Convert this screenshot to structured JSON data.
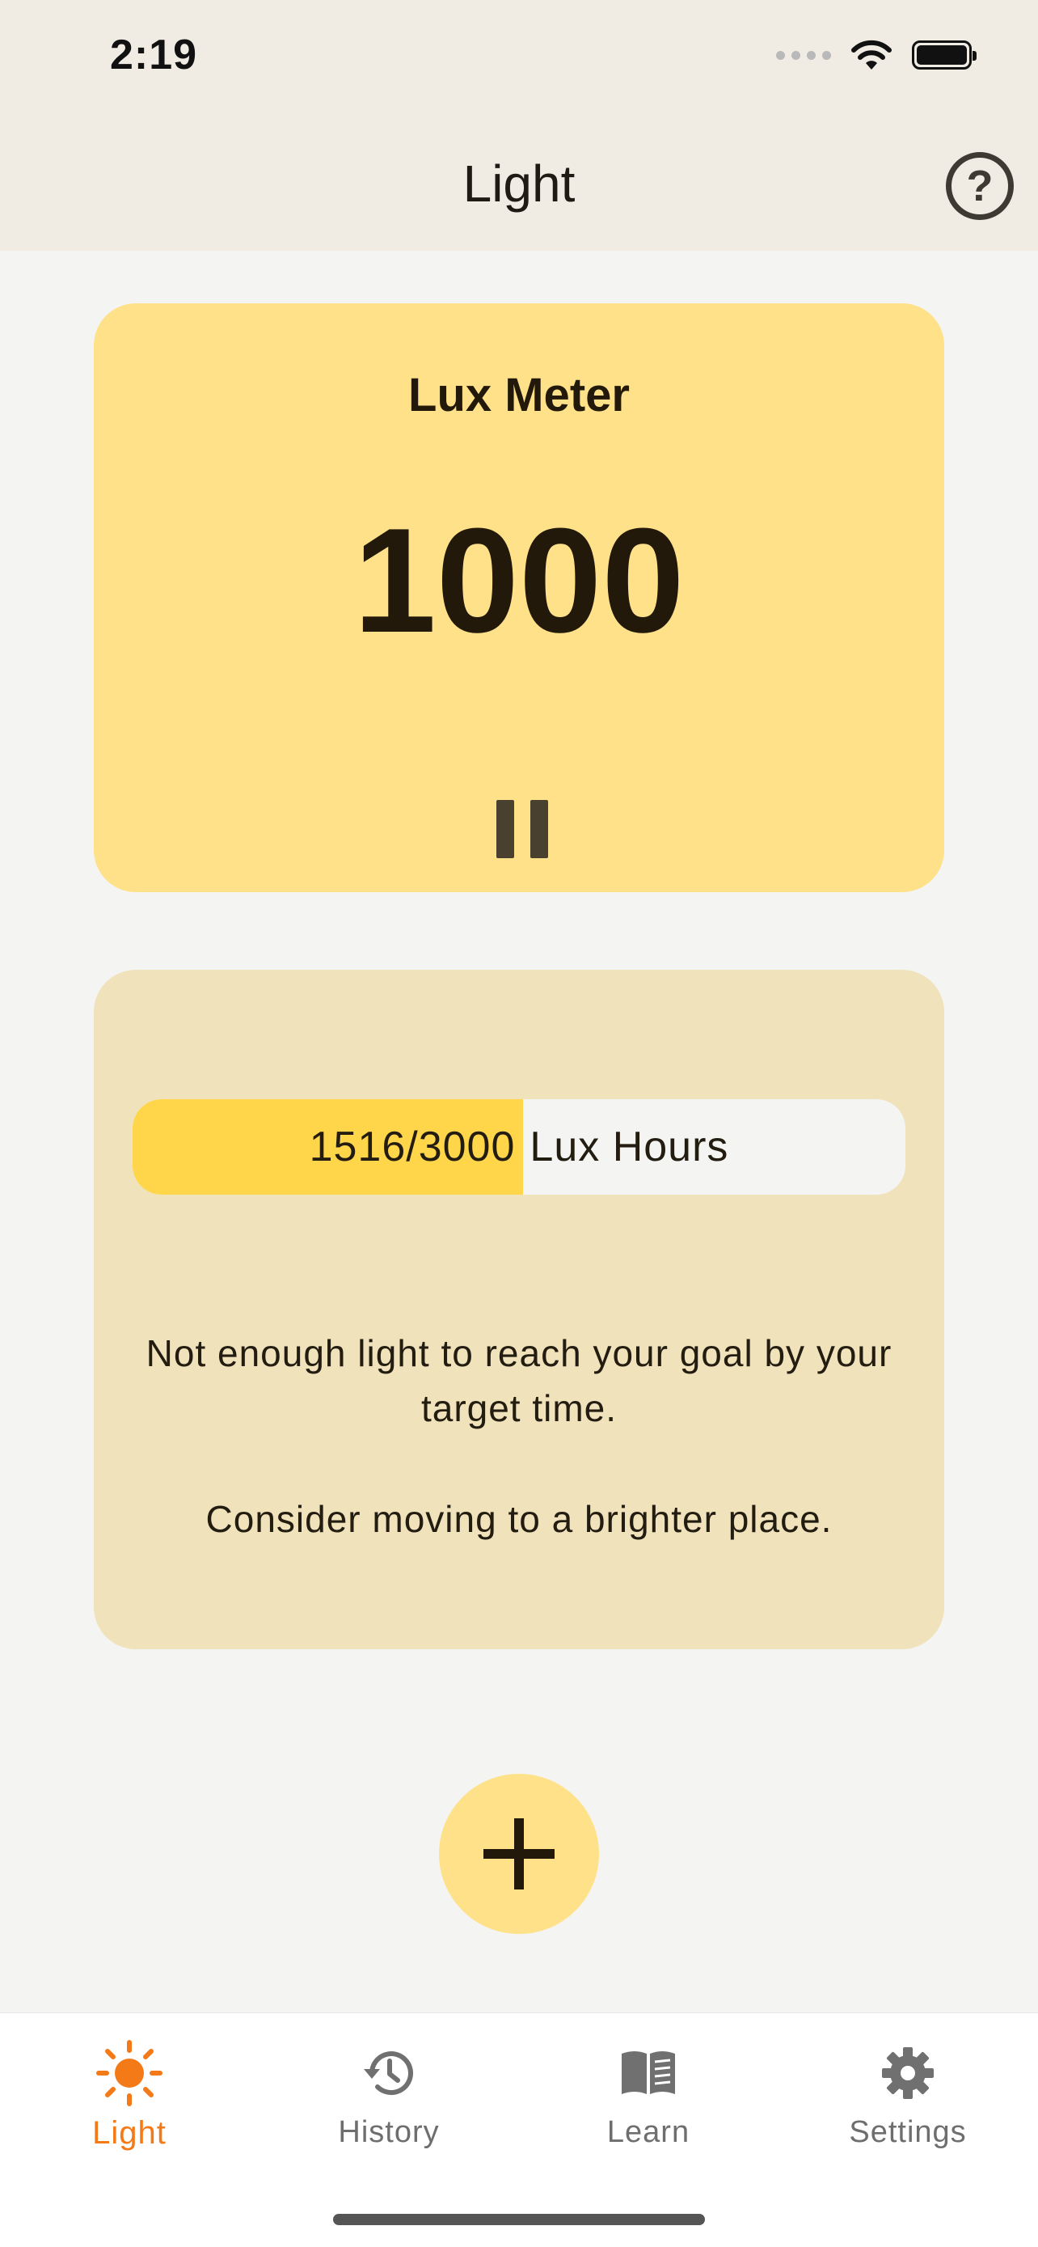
{
  "status_bar": {
    "time": "2:19"
  },
  "nav": {
    "title": "Light",
    "help_icon": "question-circle-icon",
    "help_glyph": "?"
  },
  "lux_card": {
    "title": "Lux Meter",
    "value": "1000",
    "control_icon": "pause-icon"
  },
  "progress_card": {
    "progress_value": 1516,
    "progress_goal": 3000,
    "progress_text": "1516/3000",
    "unit_text": "Lux Hours",
    "message_line1": "Not enough light to reach your goal by your target time.",
    "message_line2": "Consider moving to a brighter place."
  },
  "add_button": {
    "icon": "plus-icon"
  },
  "tabs": [
    {
      "label": "Light",
      "icon": "sun-icon",
      "active": true
    },
    {
      "label": "History",
      "icon": "history-icon",
      "active": false
    },
    {
      "label": "Learn",
      "icon": "book-icon",
      "active": false
    },
    {
      "label": "Settings",
      "icon": "gear-icon",
      "active": false
    }
  ],
  "colors": {
    "accent": "#f47a17",
    "card_yellow": "#ffe18a",
    "card_tan": "#f0e2bb",
    "progress_fill": "#ffd54a"
  }
}
